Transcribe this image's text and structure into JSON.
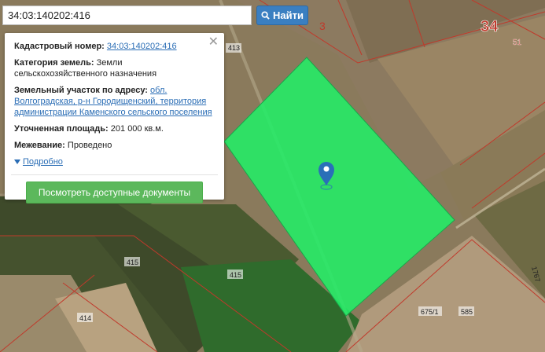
{
  "search": {
    "value": "34:03:140202:416",
    "button_label": "Найти"
  },
  "info_panel": {
    "cadastral_label": "Кадастровый номер:",
    "cadastral_value": "34:03:140202:416",
    "category_label": "Категория земель:",
    "category_value": "Земли сельскохозяйственного назначения",
    "address_label": "Земельный участок по адресу:",
    "address_value": "обл. Волгоградская, р-н Городищенский, территория администрации Каменского сельского поселения",
    "area_label": "Уточненная площадь:",
    "area_value": "201 000 кв.м.",
    "survey_label": "Межевание:",
    "survey_value": "Проведено",
    "more_label": "Подробно",
    "docs_button": "Посмотреть доступные документы",
    "close_symbol": "✕"
  },
  "map_labels": {
    "region": "34",
    "l3": "3",
    "l51": "51",
    "l413": "413",
    "l415a": "415",
    "l415b": "415",
    "l414": "414",
    "l675": "675/1",
    "l585": "585",
    "l1767": "1767"
  },
  "colors": {
    "parcel_fill": "#22ee66",
    "boundary": "#c0392b",
    "button_blue": "#3a7fc1",
    "button_green": "#5cb85c",
    "marker": "#2a6fb8"
  },
  "icons": [
    "search-icon",
    "close-icon",
    "triangle-down-icon",
    "map-marker-icon"
  ]
}
